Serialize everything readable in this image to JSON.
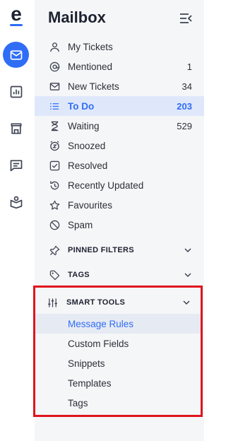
{
  "app": {
    "logo_letter": "e"
  },
  "rail": {
    "items": [
      {
        "name": "mailbox",
        "icon": "mail-icon",
        "active": true
      },
      {
        "name": "reports",
        "icon": "bar-chart-icon"
      },
      {
        "name": "store",
        "icon": "store-icon"
      },
      {
        "name": "chat",
        "icon": "chat-icon"
      },
      {
        "name": "knowledge",
        "icon": "book-icon"
      }
    ]
  },
  "panel": {
    "title": "Mailbox",
    "nav": [
      {
        "label": "My Tickets",
        "count": "",
        "icon": "user-icon"
      },
      {
        "label": "Mentioned",
        "count": "1",
        "icon": "at-icon"
      },
      {
        "label": "New Tickets",
        "count": "34",
        "icon": "envelope-icon"
      },
      {
        "label": "To Do",
        "count": "203",
        "icon": "list-icon",
        "active": true
      },
      {
        "label": "Waiting",
        "count": "529",
        "icon": "hourglass-icon"
      },
      {
        "label": "Snoozed",
        "count": "",
        "icon": "snooze-icon"
      },
      {
        "label": "Resolved",
        "count": "",
        "icon": "check-square-icon"
      },
      {
        "label": "Recently Updated",
        "count": "",
        "icon": "history-icon"
      },
      {
        "label": "Favourites",
        "count": "",
        "icon": "star-icon"
      },
      {
        "label": "Spam",
        "count": "",
        "icon": "block-icon"
      }
    ],
    "pinned_filters_label": "PINNED FILTERS",
    "tags_label": "TAGS",
    "smart_tools": {
      "label": "SMART TOOLS",
      "items": [
        {
          "label": "Message Rules",
          "active": true
        },
        {
          "label": "Custom Fields"
        },
        {
          "label": "Snippets"
        },
        {
          "label": "Templates"
        },
        {
          "label": "Tags"
        }
      ]
    }
  },
  "colors": {
    "accent": "#2f6df6",
    "highlight_border": "#e0141d",
    "panel_bg": "#f5f6f8"
  }
}
